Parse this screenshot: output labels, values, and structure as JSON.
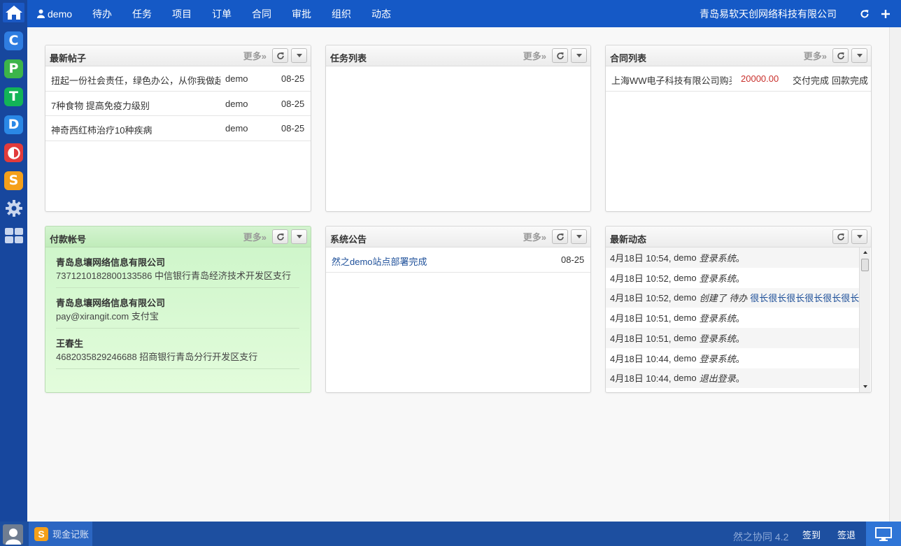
{
  "topbar": {
    "user": "demo",
    "nav": [
      "待办",
      "任务",
      "项目",
      "订单",
      "合同",
      "审批",
      "组织",
      "动态"
    ],
    "company": "青岛易软天创网络科技有限公司"
  },
  "sidebar": {
    "apps": [
      {
        "letter": "C",
        "color": "#2f7de1"
      },
      {
        "letter": "P",
        "color": "#3cb44a"
      },
      {
        "letter": "T",
        "color": "#12b457"
      },
      {
        "letter": "D",
        "color": "#2a88e6"
      },
      {
        "letter": "O",
        "color": "#e23b3b"
      },
      {
        "letter": "S",
        "color": "#f5a01a"
      }
    ]
  },
  "panels": {
    "more_label": "更多»",
    "posts": {
      "title": "最新帖子",
      "rows": [
        {
          "title": "扭起一份社会责任，绿色办公，从你我做起",
          "author": "demo",
          "date": "08-25"
        },
        {
          "title": "7种食物 提高免疫力级别",
          "author": "demo",
          "date": "08-25"
        },
        {
          "title": "神奇西红柿治疗10种疾病",
          "author": "demo",
          "date": "08-25"
        }
      ]
    },
    "tasks": {
      "title": "任务列表"
    },
    "contracts": {
      "title": "合同列表",
      "rows": [
        {
          "name": "上海WW电子科技有限公司购买",
          "amount": "20000.00",
          "delivery": "交付完成",
          "payment": "回款完成"
        }
      ]
    },
    "accounts": {
      "title": "付款帐号",
      "items": [
        {
          "name": "青岛息壤网络信息有限公司",
          "info": "7371210182800133586 中信银行青岛经济技术开发区支行"
        },
        {
          "name": "青岛息壤网络信息有限公司",
          "info": "pay@xirangit.com 支付宝"
        },
        {
          "name": "王春生",
          "info": "4682035829246688 招商银行青岛分行开发区支行"
        }
      ]
    },
    "notices": {
      "title": "系统公告",
      "rows": [
        {
          "title": "然之demo站点部署完成",
          "date": "08-25"
        }
      ]
    },
    "activity": {
      "title": "最新动态",
      "rows": [
        {
          "time": "4月18日 10:54,",
          "user": "demo",
          "action": "登录系统",
          "link": "",
          "end": "。"
        },
        {
          "time": "4月18日 10:52,",
          "user": "demo",
          "action": "登录系统",
          "link": "",
          "end": "。"
        },
        {
          "time": "4月18日 10:52,",
          "user": "demo",
          "action": "创建了 待办",
          "link": "很长很长很长很长很长很长",
          "end": ""
        },
        {
          "time": "4月18日 10:51,",
          "user": "demo",
          "action": "登录系统",
          "link": "",
          "end": "。"
        },
        {
          "time": "4月18日 10:51,",
          "user": "demo",
          "action": "登录系统",
          "link": "",
          "end": "。"
        },
        {
          "time": "4月18日 10:44,",
          "user": "demo",
          "action": "登录系统",
          "link": "",
          "end": "。"
        },
        {
          "time": "4月18日 10:44,",
          "user": "demo",
          "action": "退出登录",
          "link": "",
          "end": "。"
        }
      ]
    }
  },
  "bottombar": {
    "task_label": "现金记账",
    "version": "然之协同 4.2",
    "signin": "签到",
    "signout": "签退"
  },
  "colors": {
    "topbar": "#1559c6",
    "sidebar": "#17479e",
    "amount_red": "#c9302c",
    "link_blue": "#1d4f99"
  }
}
